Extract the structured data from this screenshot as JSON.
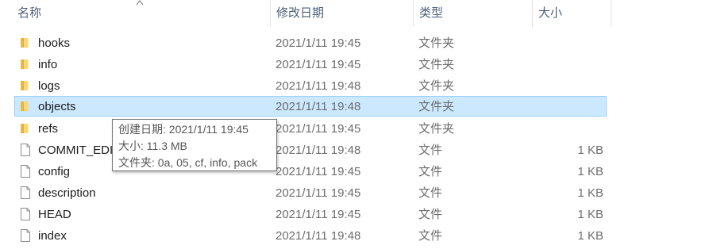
{
  "columns": {
    "name": "名称",
    "date": "修改日期",
    "type": "类型",
    "size": "大小"
  },
  "sort_column": "name",
  "files": [
    {
      "name": "hooks",
      "date": "2021/1/11 19:45",
      "type": "文件夹",
      "size": "",
      "icon": "folder-icon"
    },
    {
      "name": "info",
      "date": "2021/1/11 19:45",
      "type": "文件夹",
      "size": "",
      "icon": "folder-icon"
    },
    {
      "name": "logs",
      "date": "2021/1/11 19:48",
      "type": "文件夹",
      "size": "",
      "icon": "folder-icon"
    },
    {
      "name": "objects",
      "date": "2021/1/11 19:48",
      "type": "文件夹",
      "size": "",
      "icon": "folder-icon",
      "selected": true
    },
    {
      "name": "refs",
      "date": "2021/1/11 19:45",
      "type": "文件夹",
      "size": "",
      "icon": "folder-icon"
    },
    {
      "name": "COMMIT_EDITMSG",
      "date": "2021/1/11 19:48",
      "type": "文件",
      "size": "1 KB",
      "icon": "file-icon"
    },
    {
      "name": "config",
      "date": "2021/1/11 19:45",
      "type": "文件",
      "size": "1 KB",
      "icon": "file-icon"
    },
    {
      "name": "description",
      "date": "2021/1/11 19:45",
      "type": "文件",
      "size": "1 KB",
      "icon": "file-icon"
    },
    {
      "name": "HEAD",
      "date": "2021/1/11 19:45",
      "type": "文件",
      "size": "1 KB",
      "icon": "file-icon"
    },
    {
      "name": "index",
      "date": "2021/1/11 19:48",
      "type": "文件",
      "size": "1 KB",
      "icon": "file-icon"
    }
  ],
  "tooltip": {
    "created": "创建日期: 2021/1/11 19:45",
    "size": "大小: 11.3 MB",
    "folders": "文件夹: 0a, 05, cf, info, pack"
  },
  "colors": {
    "selection_bg": "#cce8ff",
    "selection_border": "#99d1ff",
    "folder": "#f8d775",
    "header_text": "#4c607a"
  }
}
